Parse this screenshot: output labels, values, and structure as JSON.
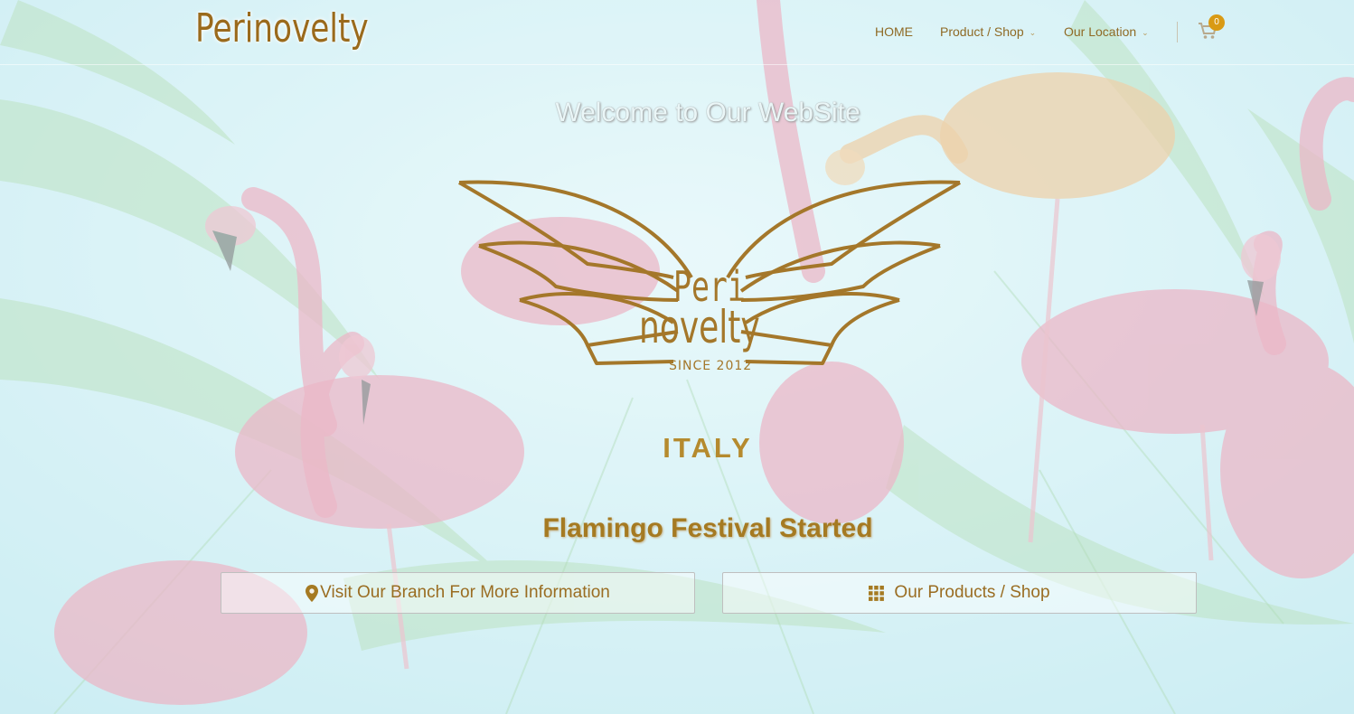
{
  "site": {
    "brand": "Perinovelty"
  },
  "nav": {
    "items": [
      {
        "label": "HOME",
        "has_dropdown": false
      },
      {
        "label": "Product / Shop",
        "has_dropdown": true
      },
      {
        "label": "Our Location",
        "has_dropdown": true
      }
    ],
    "cart_count": "0"
  },
  "hero": {
    "welcome": "Welcome to Our WebSite",
    "logo": {
      "line1": "Peri",
      "line2": "novelty",
      "since": "SINCE 2012"
    },
    "country": "ITALY",
    "headline": "Flamingo Festival Started",
    "buttons": [
      {
        "label": "Visit Our Branch For More Information",
        "icon": "map-marker-icon"
      },
      {
        "label": "Our Products / Shop",
        "icon": "grid-icon"
      }
    ]
  },
  "colors": {
    "accent": "#a57a22",
    "badge": "#d99a14",
    "sky": "#cfeef2",
    "flamingo": "#ef8fa6"
  }
}
